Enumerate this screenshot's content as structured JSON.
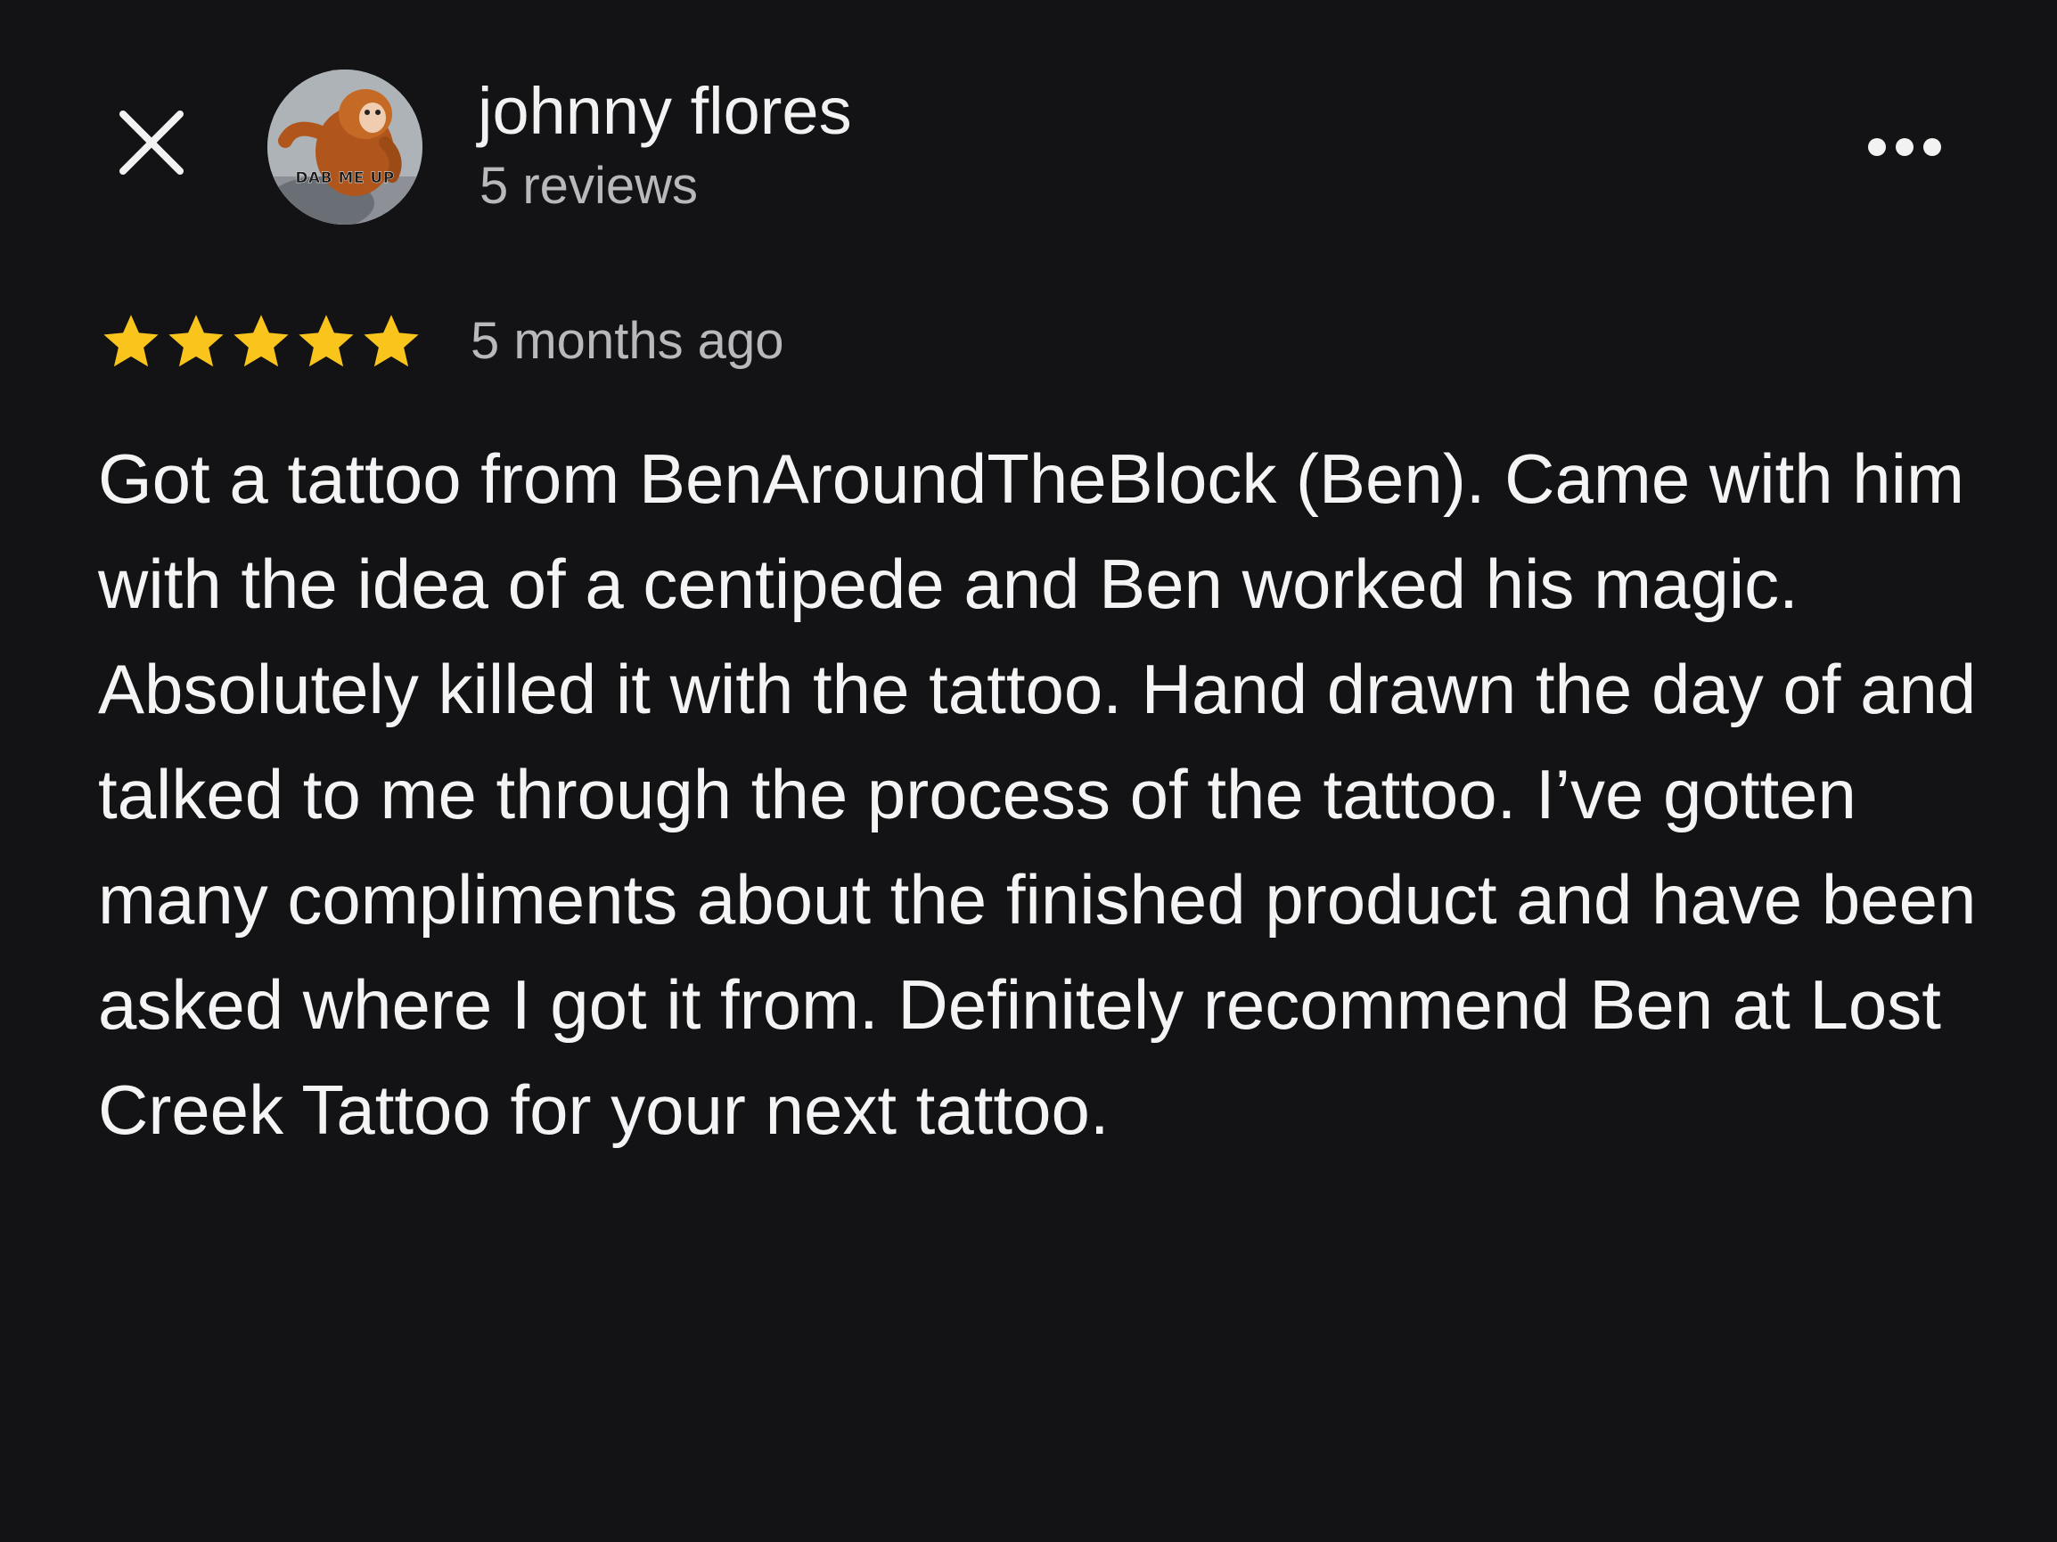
{
  "header": {
    "close_icon": "close-icon",
    "more_icon": "more-horizontal-icon",
    "avatar": {
      "caption": "DAB ME UP"
    },
    "reviewer_name": "johnny flores",
    "review_count": "5 reviews"
  },
  "review": {
    "rating": 5,
    "rating_max": 5,
    "star_color": "#F9C41B",
    "date": "5 months ago",
    "text": "Got a tattoo from BenAroundTheBlock (Ben). Came with him with the idea of a centipede and Ben worked his magic. Absolutely killed it with the tattoo. Hand drawn the day of and talked to me through the process of the tattoo. I’ve gotten many compliments about the finished product and have been asked where I got it from. Definitely recommend Ben at Lost Creek Tattoo for your next tattoo."
  },
  "colors": {
    "background": "#131315",
    "primary_text": "#F2F2F2",
    "secondary_text": "#B9B9BD"
  }
}
